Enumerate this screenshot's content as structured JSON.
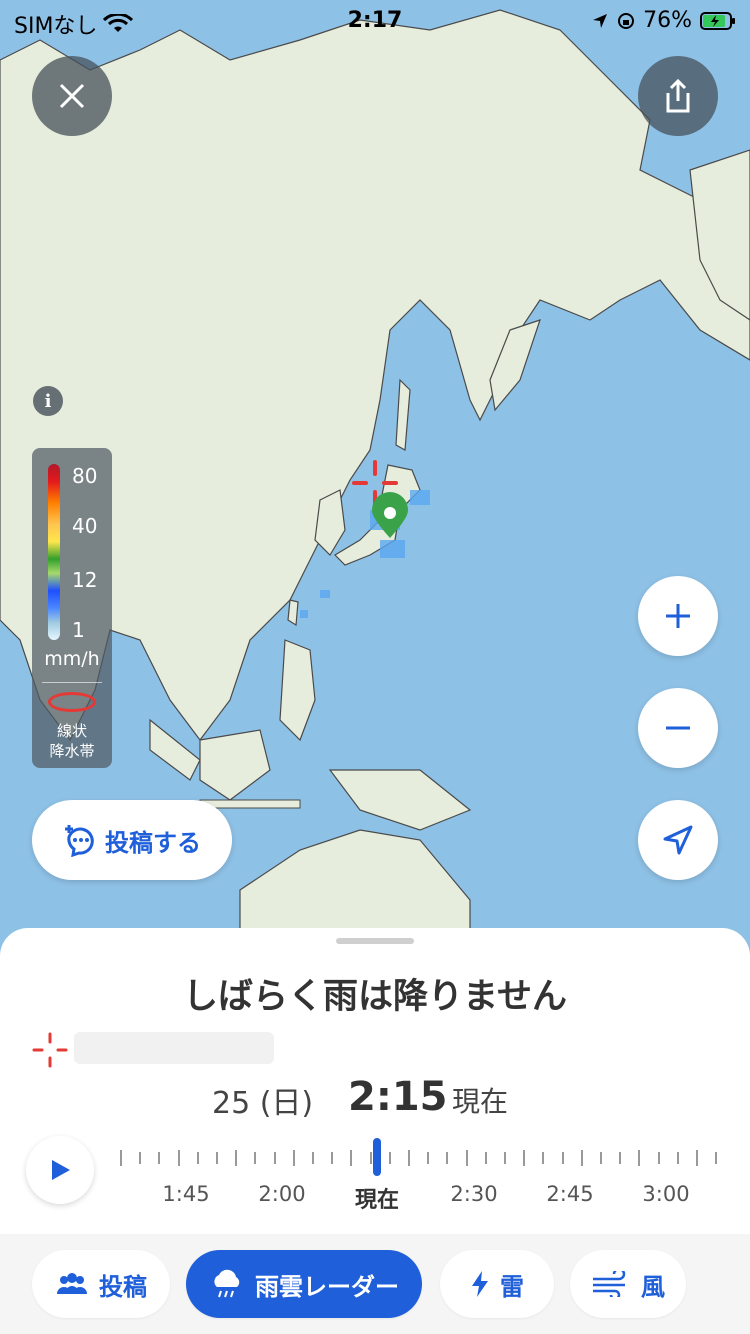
{
  "status": {
    "carrier": "SIMなし",
    "time": "2:17",
    "battery": "76%"
  },
  "legend": {
    "values": [
      "80",
      "40",
      "12",
      "1"
    ],
    "unit": "mm/h",
    "band_line1": "線状",
    "band_line2": "降水帯"
  },
  "info": {
    "label": "i"
  },
  "post_button": {
    "label": "投稿する"
  },
  "sheet": {
    "headline": "しばらく雨は降りません",
    "date": "25 (日)",
    "now_time": "2:15",
    "now_label": "現在"
  },
  "timeline": {
    "labels": [
      "1:45",
      "2:00",
      "現在",
      "2:30",
      "2:45",
      "3:00"
    ]
  },
  "bottom_nav": {
    "items": [
      {
        "label": "投稿",
        "icon": "people-icon"
      },
      {
        "label": "雨雲レーダー",
        "icon": "rain-cloud-icon"
      },
      {
        "label": "雷",
        "icon": "lightning-icon"
      },
      {
        "label": "風",
        "icon": "wind-icon"
      }
    ]
  },
  "colors": {
    "accent": "#1f5fd9",
    "marker": "#3aa34a",
    "land": "#e7eddc",
    "sea": "#8ec1e6"
  }
}
